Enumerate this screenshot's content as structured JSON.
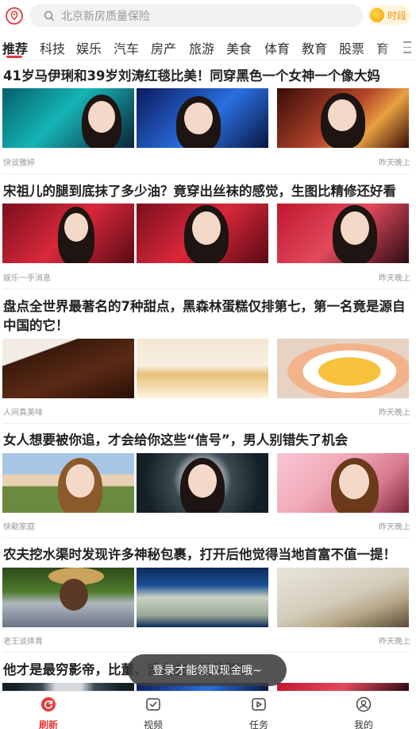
{
  "header": {
    "search_placeholder": "北京新房质量保险",
    "reward_label": "时段"
  },
  "tabs": [
    "推荐",
    "科技",
    "娱乐",
    "汽车",
    "房产",
    "旅游",
    "美食",
    "体育",
    "教育",
    "股票",
    "育"
  ],
  "articles": [
    {
      "title": "41岁马伊琍和39岁刘涛红毯比美！同穿黑色一个女神一个像大妈",
      "source": "快谈雅婷",
      "time": "昨天晚上"
    },
    {
      "title": "宋祖儿的腿到底抹了多少油？竟穿出丝袜的感觉，生图比精修还好看",
      "source": "娱乐一手消息",
      "time": "昨天晚上"
    },
    {
      "title": "盘点全世界最著名的7种甜点，黑森林蛋糕仅排第七，第一名竟是源自中国的它！",
      "source": "人间真美味",
      "time": "昨天晚上"
    },
    {
      "title": "女人想要被你追，才会给你这些“信号”，男人别错失了机会",
      "source": "快勒家庭",
      "time": "昨天晚上"
    },
    {
      "title": "农夫挖水渠时发现许多神秘包裹，打开后他觉得当地首富不值一提！",
      "source": "老王谈体育",
      "time": "昨天晚上"
    },
    {
      "title": "他才是最穷影帝，比董、没女友、没片酬！"
    }
  ],
  "toast": "登录才能领取现金哦~",
  "bottom_nav": [
    {
      "label": "刷新",
      "icon": "refresh-icon",
      "active": true
    },
    {
      "label": "视频",
      "icon": "video-icon"
    },
    {
      "label": "任务",
      "icon": "task-icon"
    },
    {
      "label": "我的",
      "icon": "profile-icon"
    }
  ],
  "colors": {
    "accent": "#e43b3b",
    "coin": "#f4a300"
  }
}
